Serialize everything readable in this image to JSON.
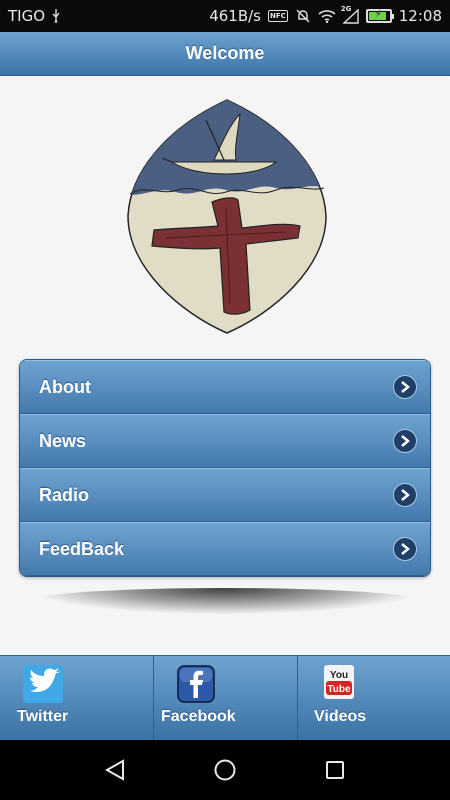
{
  "status_bar": {
    "carrier": "TIGO",
    "speed": "461B/s",
    "nfc": "NFC",
    "network": "2G",
    "time": "12:08",
    "battery_level": 0.8
  },
  "header": {
    "title": "Welcome"
  },
  "logo": {
    "description_icon": "crest-icon"
  },
  "menu": {
    "items": [
      {
        "label": "About",
        "icon": "chevron-right-icon"
      },
      {
        "label": "News",
        "icon": "chevron-right-icon"
      },
      {
        "label": "Radio",
        "icon": "chevron-right-icon"
      },
      {
        "label": "FeedBack",
        "icon": "chevron-right-icon"
      }
    ]
  },
  "tabs": [
    {
      "label": "Twitter",
      "icon": "twitter-icon"
    },
    {
      "label": "Facebook",
      "icon": "facebook-icon"
    },
    {
      "label": "Videos",
      "icon": "youtube-icon"
    }
  ],
  "youtube_text": {
    "line1": "You",
    "line2": "Tube"
  },
  "colors": {
    "accent": "#4a7fb3",
    "header_top": "#6ea2cf",
    "header_bottom": "#3d74a8"
  }
}
